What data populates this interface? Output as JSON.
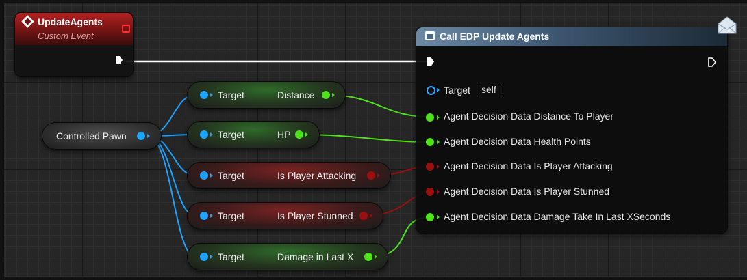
{
  "event_node": {
    "title": "UpdateAgents",
    "subtitle": "Custom Event"
  },
  "call_node": {
    "title": "Call EDP Update Agents",
    "target_label": "Target",
    "target_value": "self",
    "inputs": [
      "Agent Decision Data Distance To Player",
      "Agent Decision Data Health Points",
      "Agent Decision Data Is Player Attacking",
      "Agent Decision Data Is Player Stunned",
      "Agent Decision Data Damage Take In Last XSeconds"
    ]
  },
  "pawn_node": {
    "label": "Controlled Pawn"
  },
  "getters": [
    {
      "target_label": "Target",
      "output": "Distance",
      "type": "float"
    },
    {
      "target_label": "Target",
      "output": "HP",
      "type": "float"
    },
    {
      "target_label": "Target",
      "output": "Is Player Attacking",
      "type": "bool"
    },
    {
      "target_label": "Target",
      "output": "Is Player Stunned",
      "type": "bool"
    },
    {
      "target_label": "Target",
      "output": "Damage in Last X",
      "type": "float"
    }
  ],
  "colors": {
    "object_pin": "#1ea3ff",
    "float_pin": "#4ee21a",
    "bool_pin": "#9a0f0f",
    "exec_pin": "#ffffff",
    "event_header": "#b42222",
    "function_header": "#6c89a4"
  },
  "icons": [
    "event-diamond-icon",
    "stop-icon",
    "function-icon",
    "envelope-icon",
    "exec-pin-icon"
  ]
}
